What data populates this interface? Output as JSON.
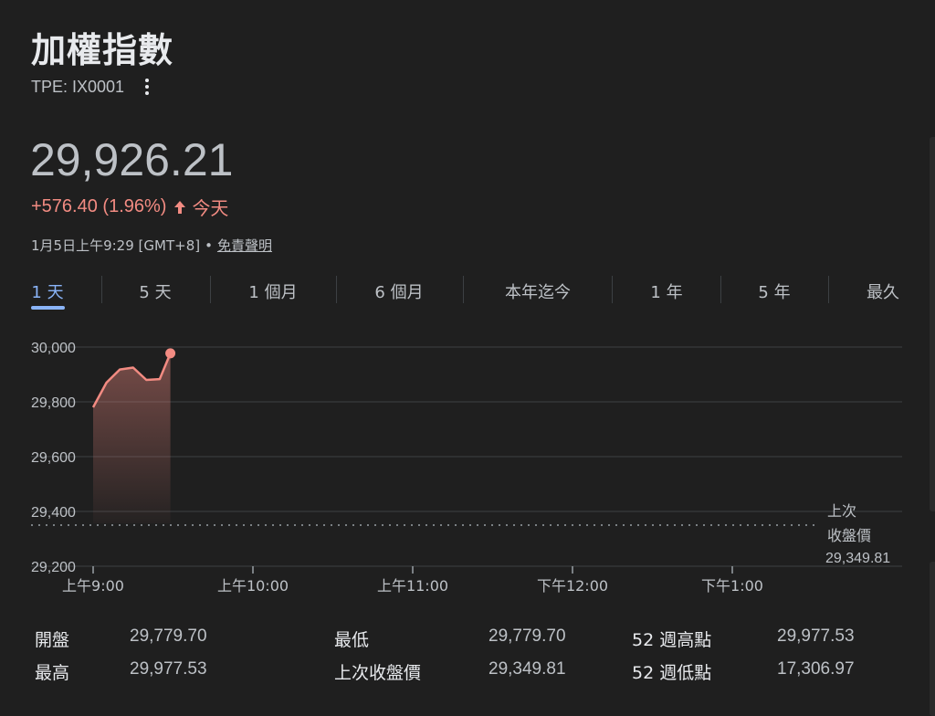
{
  "header": {
    "title": "加權指數",
    "ticker": "TPE: IX0001",
    "more_icon": "more-vert-icon"
  },
  "quote": {
    "price": "29,926.21",
    "change": "+576.40 (1.96%)",
    "direction_icon": "arrow-up-icon",
    "period": "今天",
    "timestamp": "1月5日上午9:29 [GMT+8]",
    "separator": "•",
    "disclaimer": "免責聲明",
    "up_color": "#f28b82"
  },
  "tabs": [
    {
      "label": "1 天",
      "active": true
    },
    {
      "label": "5 天",
      "active": false
    },
    {
      "label": "1 個月",
      "active": false
    },
    {
      "label": "6 個月",
      "active": false
    },
    {
      "label": "本年迄今",
      "active": false
    },
    {
      "label": "1 年",
      "active": false
    },
    {
      "label": "5 年",
      "active": false
    },
    {
      "label": "最久",
      "active": false
    }
  ],
  "chart_data": {
    "type": "area",
    "series": [
      {
        "x": [
          "09:00",
          "09:05",
          "09:10",
          "09:15",
          "09:20",
          "09:25",
          "09:29"
        ],
        "values": [
          29780,
          29870,
          29918,
          29925,
          29880,
          29883,
          29977
        ]
      }
    ],
    "y_ticks": [
      "30,000",
      "29,800",
      "29,600",
      "29,400",
      "29,200"
    ],
    "ylim": [
      29200,
      30000
    ],
    "x_ticks": [
      "上午9:00",
      "上午10:00",
      "上午11:00",
      "下午12:00",
      "下午1:00"
    ],
    "x_domain_hours": [
      9.0,
      13.5
    ],
    "previous_close": {
      "value": 29349.81,
      "label_line1": "上次",
      "label_line2": "收盤價",
      "label_value": "29,349.81"
    },
    "grid": true,
    "line_color": "#f28b82"
  },
  "stats": [
    {
      "label": "開盤",
      "value": "29,779.70"
    },
    {
      "label": "最高",
      "value": "29,977.53"
    },
    {
      "label": "最低",
      "value": "29,779.70"
    },
    {
      "label": "上次收盤價",
      "value": "29,349.81"
    },
    {
      "label": "52 週高點",
      "value": "29,977.53"
    },
    {
      "label": "52 週低點",
      "value": "17,306.97"
    }
  ]
}
